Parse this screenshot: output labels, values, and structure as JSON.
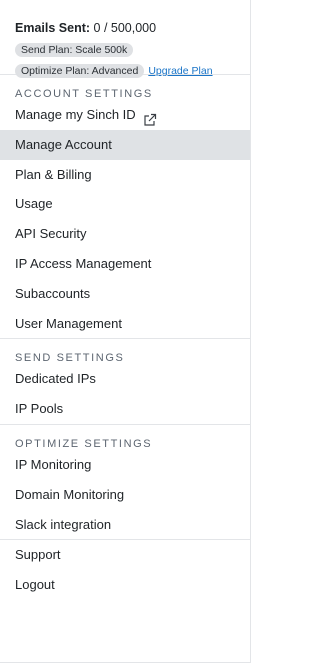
{
  "account": {
    "emails_sent_label": "Emails Sent:",
    "emails_sent_value": "0 / 500,000",
    "send_plan": "Send Plan: Scale 500k",
    "optimize_plan": "Optimize Plan: Advanced",
    "upgrade_link": "Upgrade Plan"
  },
  "account_settings": {
    "heading": "ACCOUNT SETTINGS",
    "items": [
      {
        "label": "Manage my Sinch ID",
        "icon": "external-link-icon"
      },
      {
        "label": "Manage Account",
        "active": true
      },
      {
        "label": "Plan & Billing"
      },
      {
        "label": "Usage"
      },
      {
        "label": "API Security"
      },
      {
        "label": "IP Access Management"
      },
      {
        "label": "Subaccounts"
      },
      {
        "label": "User Management"
      }
    ]
  },
  "send_settings": {
    "heading": "SEND SETTINGS",
    "items": [
      {
        "label": "Dedicated IPs"
      },
      {
        "label": "IP Pools"
      }
    ]
  },
  "optimize_settings": {
    "heading": "OPTIMIZE SETTINGS",
    "items": [
      {
        "label": "IP Monitoring"
      },
      {
        "label": "Domain Monitoring"
      },
      {
        "label": "Slack integration"
      }
    ]
  },
  "footer": {
    "items": [
      {
        "label": "Support"
      },
      {
        "label": "Logout"
      }
    ]
  },
  "colors": {
    "active_bg": "#dfe2e5",
    "link": "#1a74c7",
    "pill_bg": "#dfe1e4"
  }
}
